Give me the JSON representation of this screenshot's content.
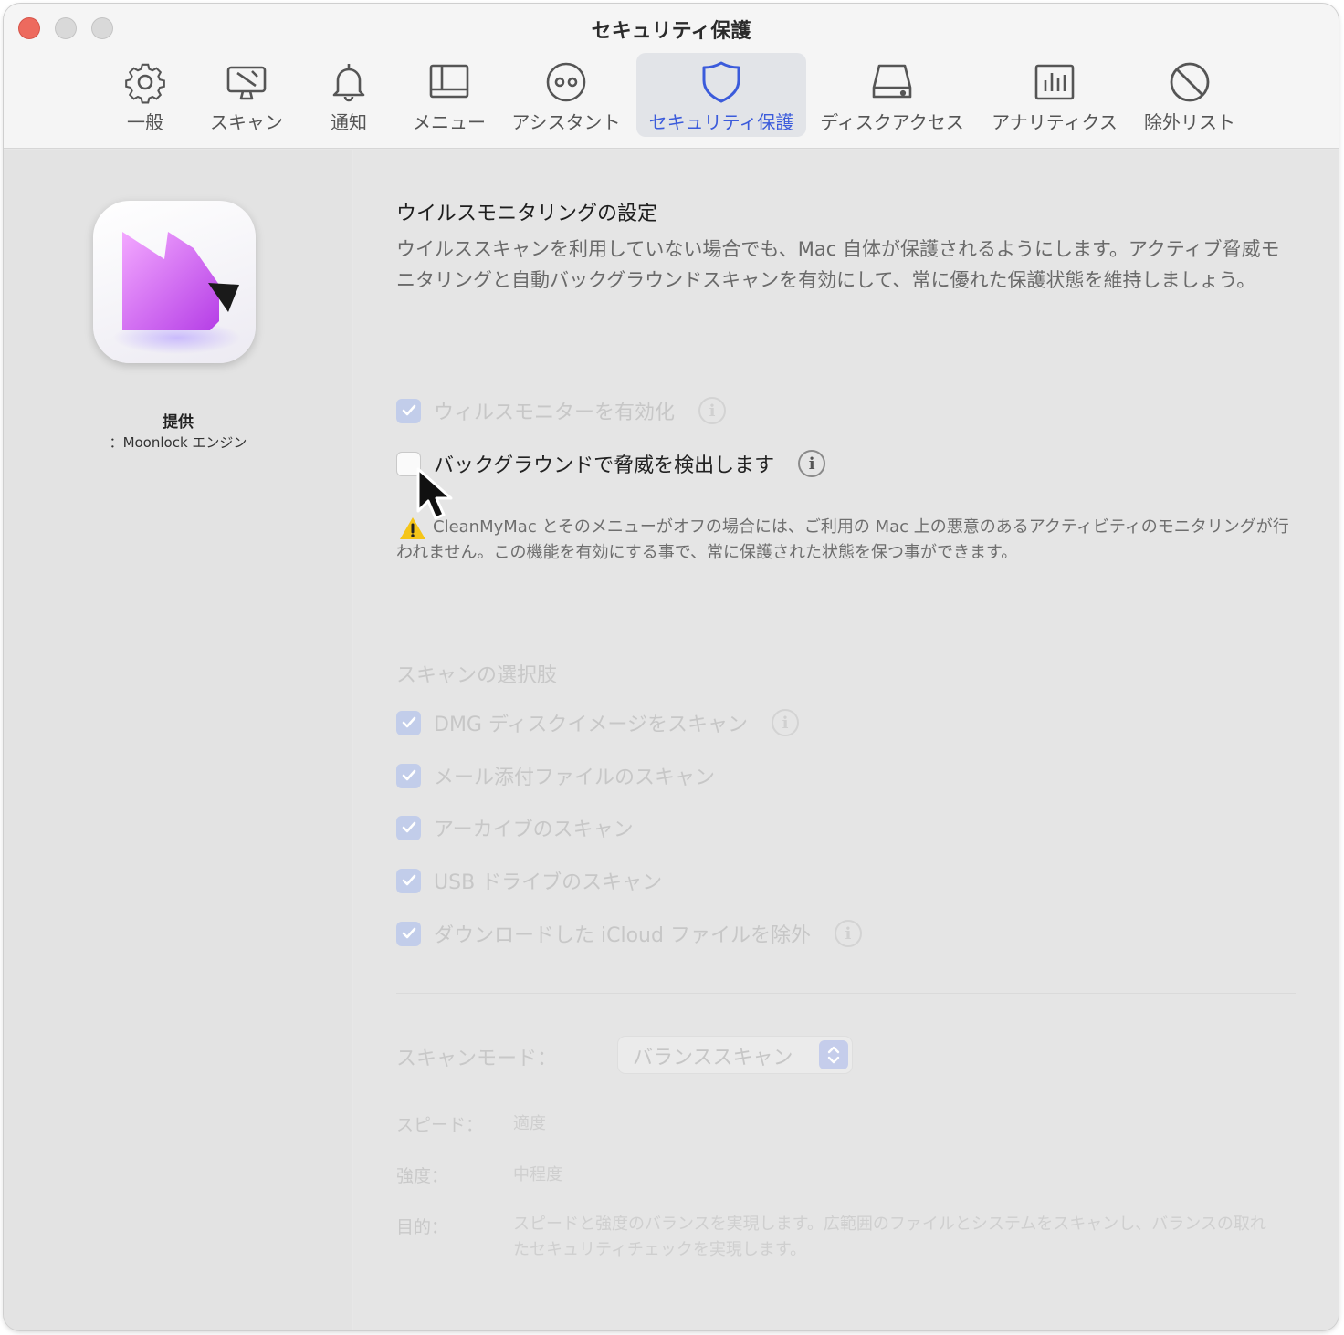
{
  "window": {
    "title": "セキュリティ保護"
  },
  "tabs": [
    {
      "label": "一般",
      "icon": "gear-icon"
    },
    {
      "label": "スキャン",
      "icon": "scan-monitor-icon"
    },
    {
      "label": "通知",
      "icon": "bell-icon"
    },
    {
      "label": "メニュー",
      "icon": "menu-icon"
    },
    {
      "label": "アシスタント",
      "icon": "assistant-icon"
    },
    {
      "label": "セキュリティ保護",
      "icon": "shield-icon",
      "active": true
    },
    {
      "label": "ディスクアクセス",
      "icon": "disk-icon"
    },
    {
      "label": "アナリティクス",
      "icon": "analytics-icon"
    },
    {
      "label": "除外リスト",
      "icon": "prohibited-icon"
    }
  ],
  "sidebar": {
    "provider_title": "提供",
    "provider_name": "：Moonlock エンジン"
  },
  "monitoring": {
    "title": "ウイルスモニタリングの設定",
    "description": "ウイルススキャンを利用していない場合でも、Mac 自体が保護されるようにします。アクティブ脅威モニタリングと自動バックグラウンドスキャンを有効にして、常に優れた保護状態を維持しましょう。",
    "enable_monitor": {
      "label": "ウィルスモニターを有効化",
      "checked": true,
      "enabled": false
    },
    "background_detect": {
      "label": "バックグラウンドで脅威を検出します",
      "checked": false,
      "enabled": true
    },
    "warning": "CleanMyMac とそのメニューがオフの場合には、ご利用の Mac 上の悪意のあるアクティビティのモニタリングが行われません。この機能を有効にする事で、常に保護された状態を保つ事ができます。"
  },
  "scan_options": {
    "title": "スキャンの選択肢",
    "items": [
      {
        "label": "DMG ディスクイメージをスキャン",
        "checked": true,
        "info": true
      },
      {
        "label": "メール添付ファイルのスキャン",
        "checked": true,
        "info": false
      },
      {
        "label": "アーカイブのスキャン",
        "checked": true,
        "info": false
      },
      {
        "label": "USB ドライブのスキャン",
        "checked": true,
        "info": false
      },
      {
        "label": "ダウンロードした iCloud ファイルを除外",
        "checked": true,
        "info": true
      }
    ]
  },
  "scan_mode": {
    "label": "スキャンモード：",
    "selected": "バランススキャン",
    "speed_label": "スピード：",
    "speed_value": "適度",
    "strength_label": "強度：",
    "strength_value": "中程度",
    "purpose_label": "目的：",
    "purpose_value": "スピードと強度のバランスを実現します。広範囲のファイルとシステムをスキャンし、バランスの取れたセキュリティチェックを実現します。"
  },
  "colors": {
    "accent": "#3b5bdb",
    "close_button": "#ed6a5e",
    "warning_icon": "#f5c518",
    "app_icon_gradient_start": "#f0a0ff",
    "app_icon_gradient_end": "#b040e0"
  }
}
